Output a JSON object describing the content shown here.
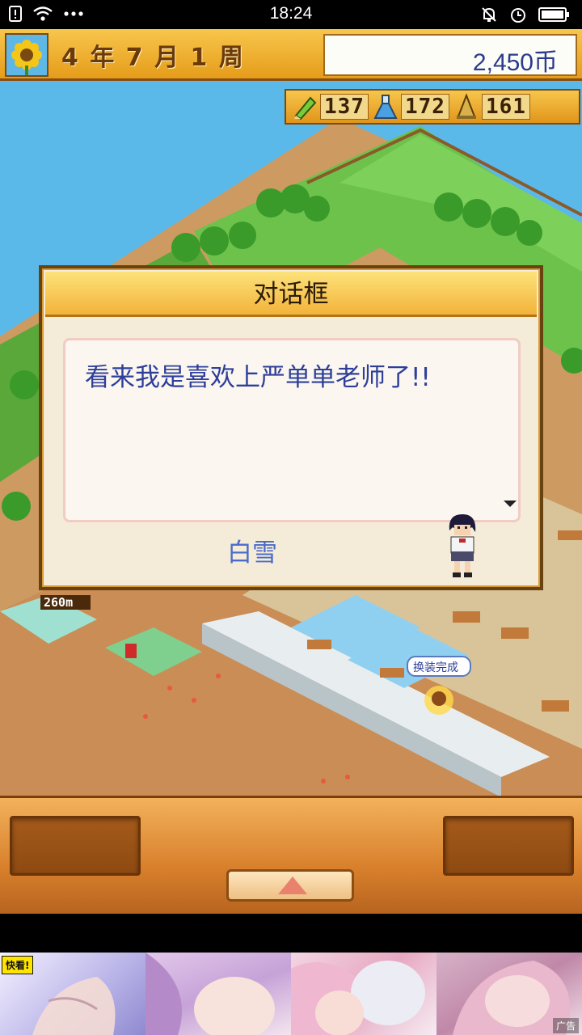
{
  "status_bar": {
    "time": "18:24",
    "left_icons": [
      "notification-icon",
      "wifi-icon",
      "more-dots-icon"
    ],
    "right_icons": [
      "mute-icon",
      "alarm-icon",
      "battery-icon"
    ]
  },
  "hud": {
    "date": "4 年 7 月 1 周",
    "coins": "2,450币",
    "stats": [
      {
        "icon": "pencil-icon",
        "value": "137"
      },
      {
        "icon": "flask-icon",
        "value": "172"
      },
      {
        "icon": "bell-icon",
        "value": "161"
      }
    ]
  },
  "dialog": {
    "title": "对话框",
    "message": "看来我是喜欢上严单单老师了!!",
    "speaker": "白雪"
  },
  "scene": {
    "floor_label": "260m",
    "bubble": "换装完成"
  },
  "controls": {
    "up_button": "up-arrow"
  },
  "ad": {
    "logo": "快看!",
    "label": "广告"
  },
  "colors": {
    "hud_gold": "#f7c64c",
    "dialog_bg": "#f4ecd8",
    "dialog_text": "#2d3f9a",
    "speaker_text": "#4a6bc9",
    "panel": "#d8802c"
  }
}
